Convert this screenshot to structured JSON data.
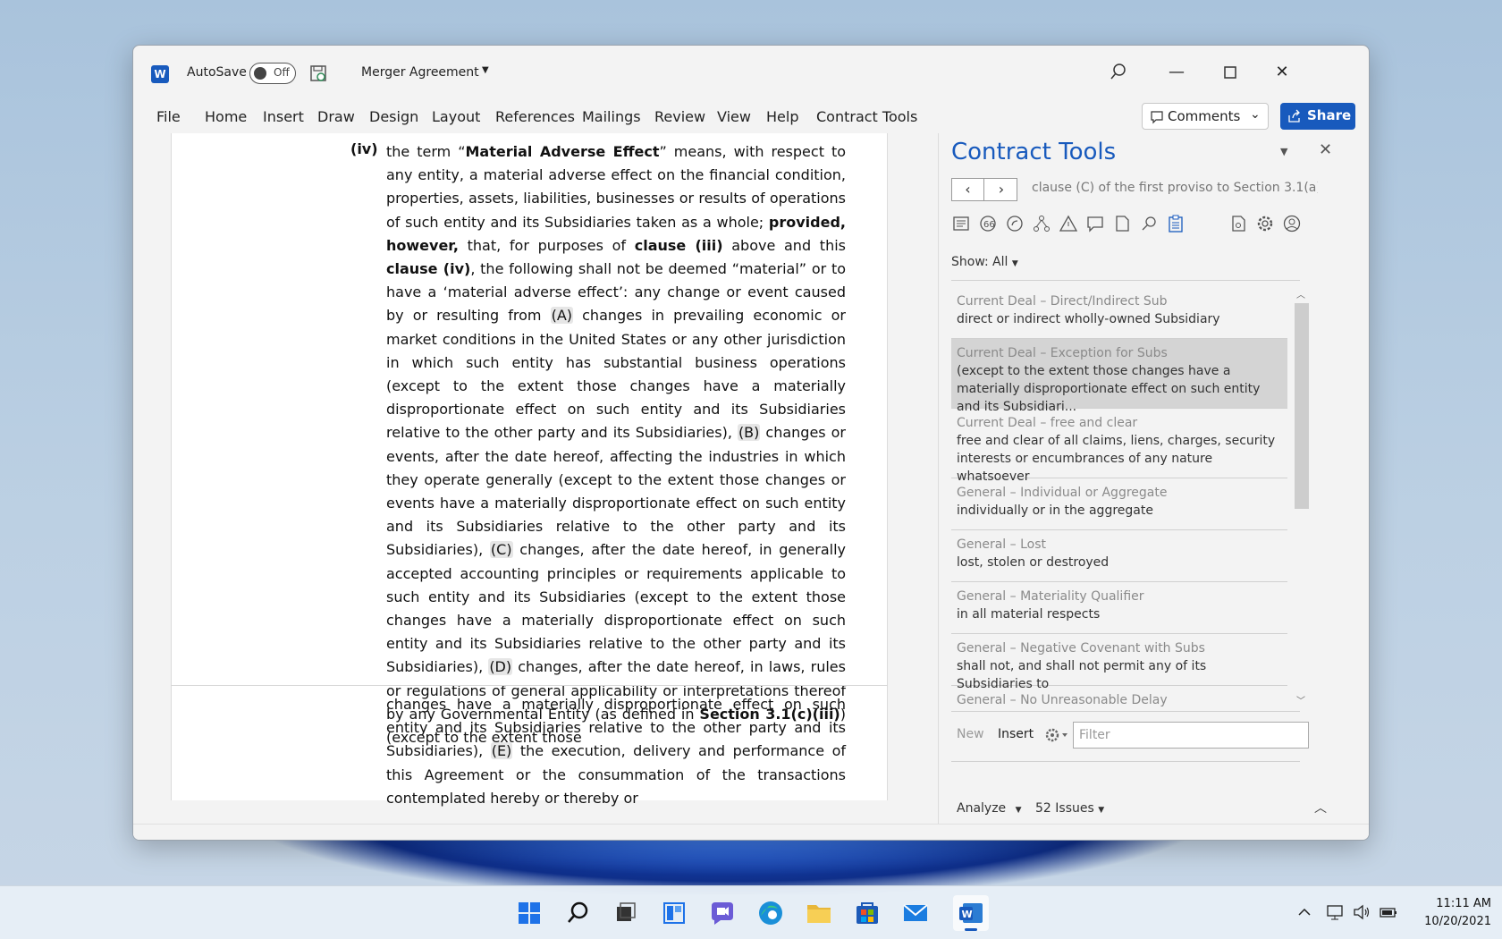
{
  "titlebar": {
    "autosave_label": "AutoSave",
    "autosave_state": "Off",
    "document_title": "Merger Agreement"
  },
  "menu": {
    "items": [
      "File",
      "Home",
      "Insert",
      "Draw",
      "Design",
      "Layout",
      "References",
      "Mailings",
      "Review",
      "View",
      "Help",
      "Contract Tools"
    ],
    "comments_label": "Comments",
    "share_label": "Share"
  },
  "document": {
    "clause_number": "(iv)"
  },
  "pane": {
    "title": "Contract Tools",
    "nav_path": "clause (C) of the first proviso to Section 3.1(a)...",
    "show_label": "Show:",
    "show_value": "All",
    "snippets": [
      {
        "title": "Current Deal – Direct/Indirect Sub",
        "text": "direct or indirect wholly-owned Subsidiary"
      },
      {
        "title": "Current Deal – Exception for Subs",
        "text": "(except to the extent those changes have a materially disproportionate effect on such entity and its Subsidiari..."
      },
      {
        "title": "Current Deal – free and clear",
        "text": "free and clear of all claims, liens, charges, security interests or encumbrances of any nature whatsoever"
      },
      {
        "title": "General – Individual or Aggregate",
        "text": "individually or in the aggregate"
      },
      {
        "title": "General – Lost",
        "text": "lost, stolen or destroyed"
      },
      {
        "title": "General – Materiality Qualifier",
        "text": "in all material respects"
      },
      {
        "title": "General – Negative Covenant with Subs",
        "text": "shall not, and shall not permit any of its Subsidiaries to"
      },
      {
        "title": "General – No Unreasonable Delay",
        "text": ""
      }
    ],
    "new_label": "New",
    "insert_label": "Insert",
    "filter_placeholder": "Filter",
    "analyze_label": "Analyze",
    "issues_label": "52 Issues"
  },
  "taskbar": {
    "time": "11:11 AM",
    "date": "10/20/2021"
  },
  "colors": {
    "accent": "#185abd",
    "pane_title": "#185abd"
  }
}
